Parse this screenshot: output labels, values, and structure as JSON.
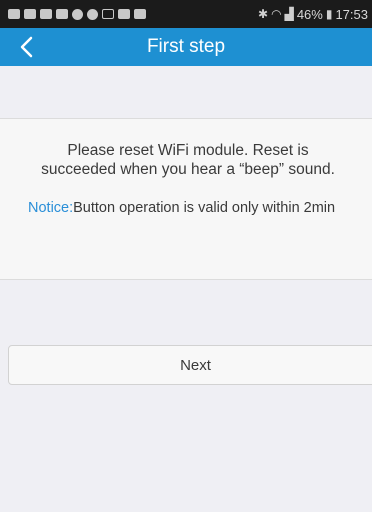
{
  "status_bar": {
    "battery": "46%",
    "time": "17:53"
  },
  "nav": {
    "title": "First step"
  },
  "content": {
    "instruction": "Please reset WiFi module. Reset is succeeded when you hear a “beep” sound.",
    "notice_label": "Notice:",
    "notice_text": "Button operation is valid only within 2min"
  },
  "actions": {
    "next_label": "Next"
  },
  "colors": {
    "nav_background": "#1e90d2",
    "notice_label": "#2a8fd8"
  }
}
